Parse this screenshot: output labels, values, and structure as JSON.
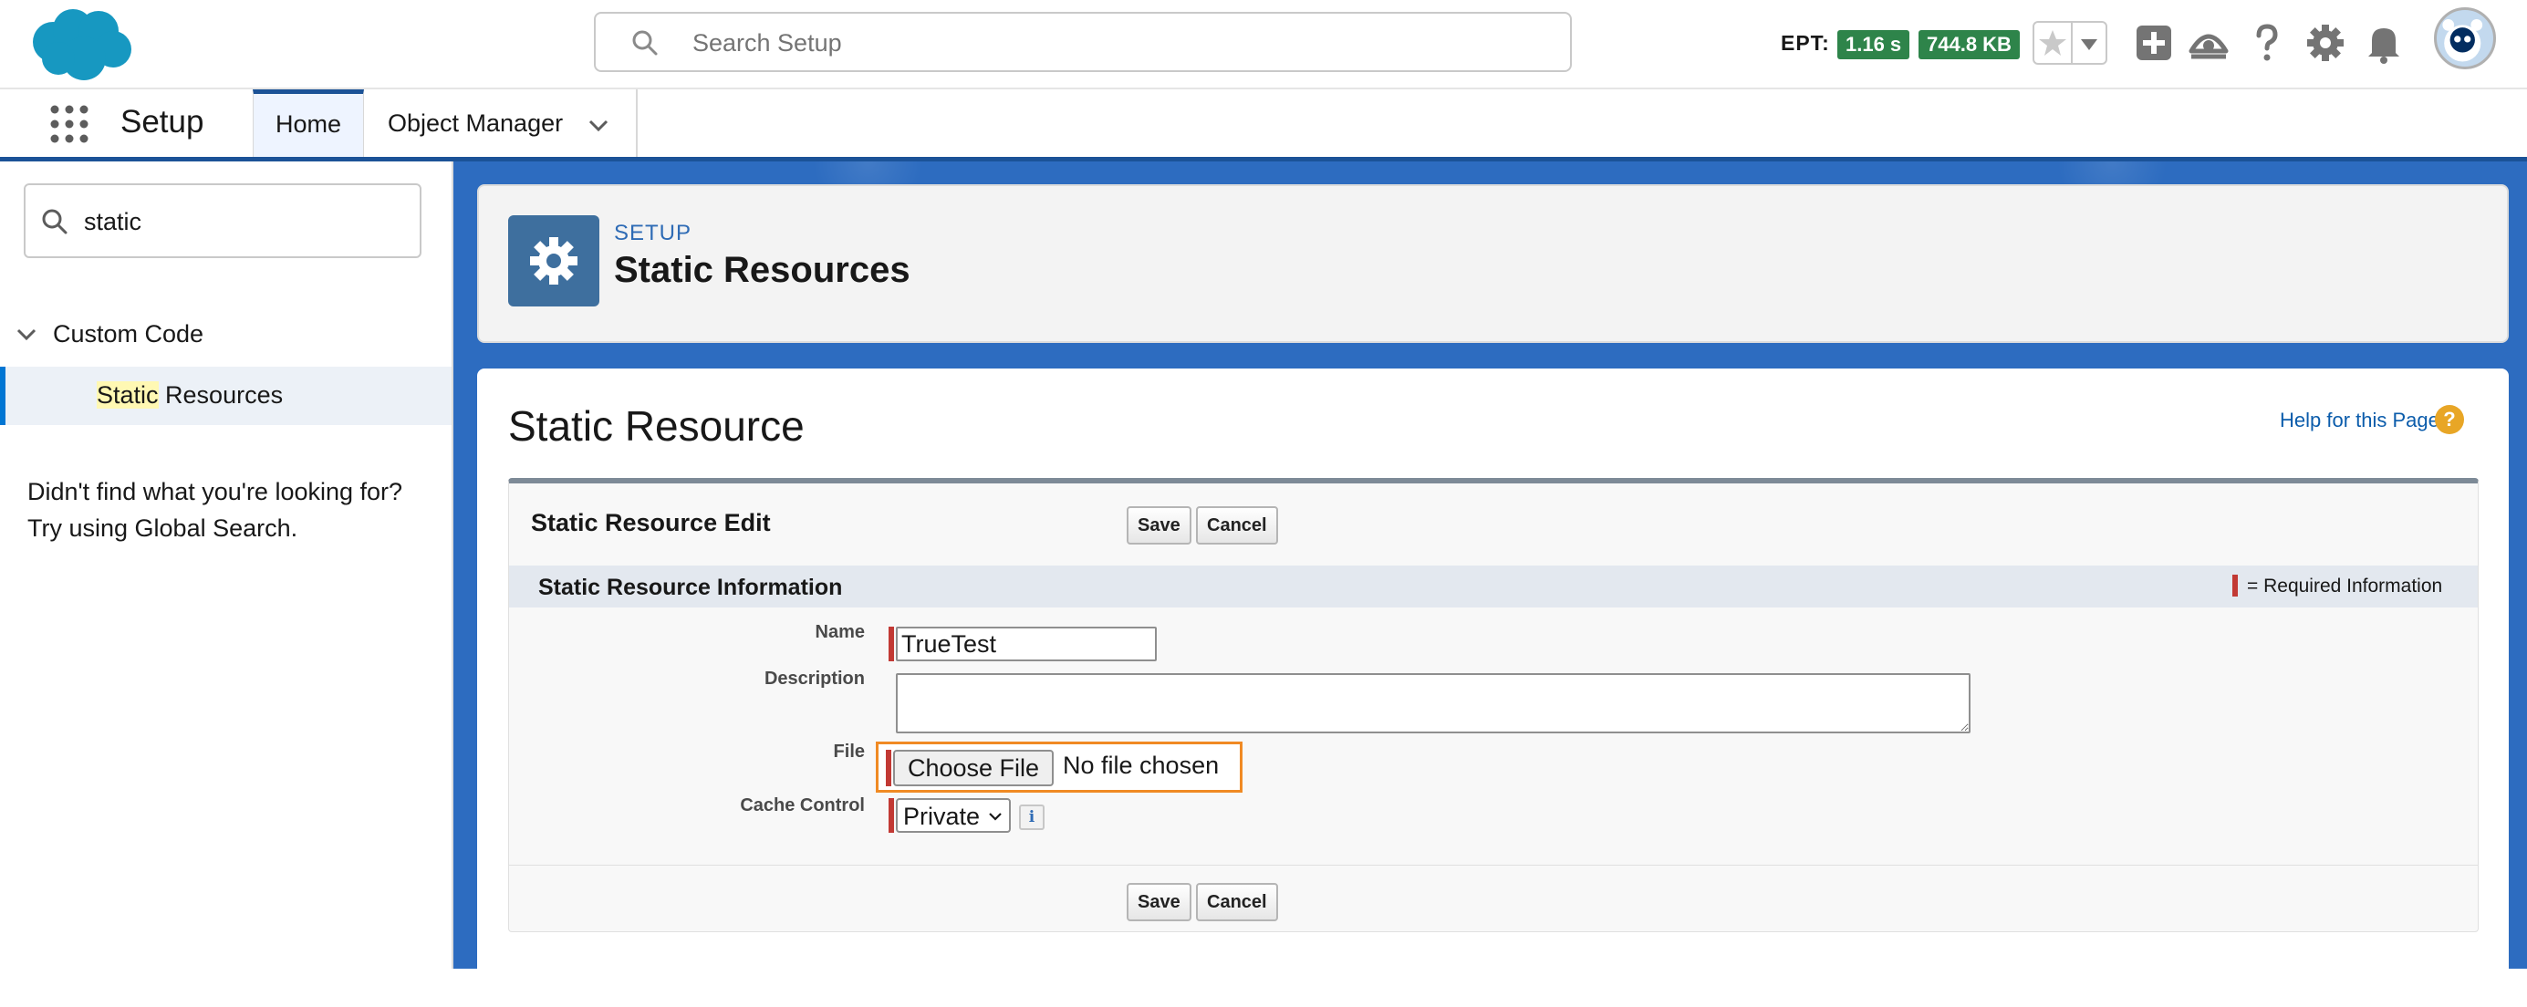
{
  "header": {
    "search_placeholder": "Search Setup",
    "ept_label": "EPT:",
    "ept_time": "1.16 s",
    "ept_size": "744.8 KB"
  },
  "nav": {
    "app_name": "Setup",
    "tabs": [
      {
        "label": "Home",
        "active": true
      },
      {
        "label": "Object Manager",
        "active": false
      }
    ]
  },
  "sidebar": {
    "quickfind_value": "static",
    "tree_parent": "Custom Code",
    "tree_child_highlight": "Static",
    "tree_child_rest": " Resources",
    "nofind_line1": "Didn't find what you're looking for?",
    "nofind_line2": "Try using Global Search."
  },
  "page_header": {
    "eyebrow": "SETUP",
    "title": "Static Resources"
  },
  "main": {
    "title": "Static Resource",
    "help_link": "Help for this Page",
    "block_title": "Static Resource Edit",
    "save_label": "Save",
    "cancel_label": "Cancel",
    "section_title": "Static Resource Information",
    "required_note": "= Required Information",
    "fields": {
      "name_label": "Name",
      "name_value": "TrueTest",
      "description_label": "Description",
      "description_value": "",
      "file_label": "File",
      "file_button": "Choose File",
      "file_status": "No file chosen",
      "cache_label": "Cache Control",
      "cache_value": "Private"
    }
  },
  "colors": {
    "brand_blue": "#1b5297",
    "ept_badge": "#2e844a",
    "required": "#c23934",
    "focus_outline": "#f08a24"
  },
  "icons": [
    "salesforce-cloud-logo",
    "search-icon",
    "star-icon",
    "chevron-down-icon",
    "plus-icon",
    "trailhead-icon",
    "help-icon",
    "gear-icon",
    "bell-icon",
    "avatar",
    "app-launcher-icon",
    "info-icon"
  ]
}
